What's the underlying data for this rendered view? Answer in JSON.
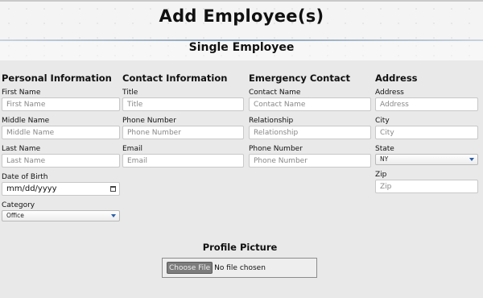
{
  "page": {
    "title": "Add Employee(s)",
    "subtitle": "Single Employee"
  },
  "columns": {
    "personal": {
      "heading": "Personal Information",
      "first_name": {
        "label": "First Name",
        "placeholder": "First Name"
      },
      "middle_name": {
        "label": "Middle Name",
        "placeholder": "Middle Name"
      },
      "last_name": {
        "label": "Last Name",
        "placeholder": "Last Name"
      },
      "dob": {
        "label": "Date of Birth",
        "value": "mm/dd/yyyy"
      },
      "category": {
        "label": "Category",
        "value": "Office"
      }
    },
    "contact": {
      "heading": "Contact Information",
      "title": {
        "label": "Title",
        "placeholder": "Title"
      },
      "phone": {
        "label": "Phone Number",
        "placeholder": "Phone Number"
      },
      "email": {
        "label": "Email",
        "placeholder": "Email"
      }
    },
    "emergency": {
      "heading": "Emergency Contact",
      "name": {
        "label": "Contact Name",
        "placeholder": "Contact Name"
      },
      "relationship": {
        "label": "Relationship",
        "placeholder": "Relationship"
      },
      "phone": {
        "label": "Phone Number",
        "placeholder": "Phone Number"
      }
    },
    "address": {
      "heading": "Address",
      "address": {
        "label": "Address",
        "placeholder": "Address"
      },
      "city": {
        "label": "City",
        "placeholder": "City"
      },
      "state": {
        "label": "State",
        "value": "NY"
      },
      "zip": {
        "label": "Zip",
        "placeholder": "Zip"
      }
    }
  },
  "profile_picture": {
    "heading": "Profile Picture",
    "button_label": "Choose File",
    "status": "No file chosen"
  },
  "icons": {
    "date_picker": "calendar-icon",
    "dropdown": "chevron-down-icon"
  },
  "colors": {
    "divider": "#8aa2bb",
    "dropdown_arrow": "#2a5fa8",
    "file_button": "#7c7c7c"
  }
}
